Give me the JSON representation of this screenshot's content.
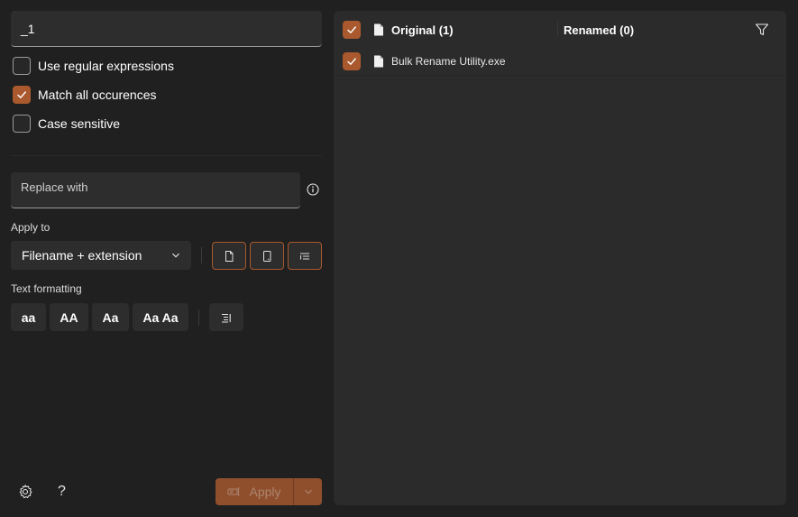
{
  "search": {
    "value": "_1"
  },
  "options": [
    {
      "label": "Use regular expressions",
      "checked": false
    },
    {
      "label": "Match all occurences",
      "checked": true
    },
    {
      "label": "Case sensitive",
      "checked": false
    }
  ],
  "replace": {
    "placeholder": "Replace with"
  },
  "apply_to": {
    "label": "Apply to",
    "selected": "Filename + extension"
  },
  "text_formatting": {
    "label": "Text formatting",
    "buttons": [
      "aa",
      "AA",
      "Aa",
      "Aa Aa"
    ]
  },
  "footer": {
    "apply_label": "Apply"
  },
  "list": {
    "original_header": "Original (1)",
    "renamed_header": "Renamed (0)",
    "files": [
      {
        "name": "Bulk Rename Utility.exe",
        "checked": true
      }
    ]
  },
  "colors": {
    "accent": "#a9592d",
    "background": "#202020",
    "panel": "#2b2b2b"
  }
}
